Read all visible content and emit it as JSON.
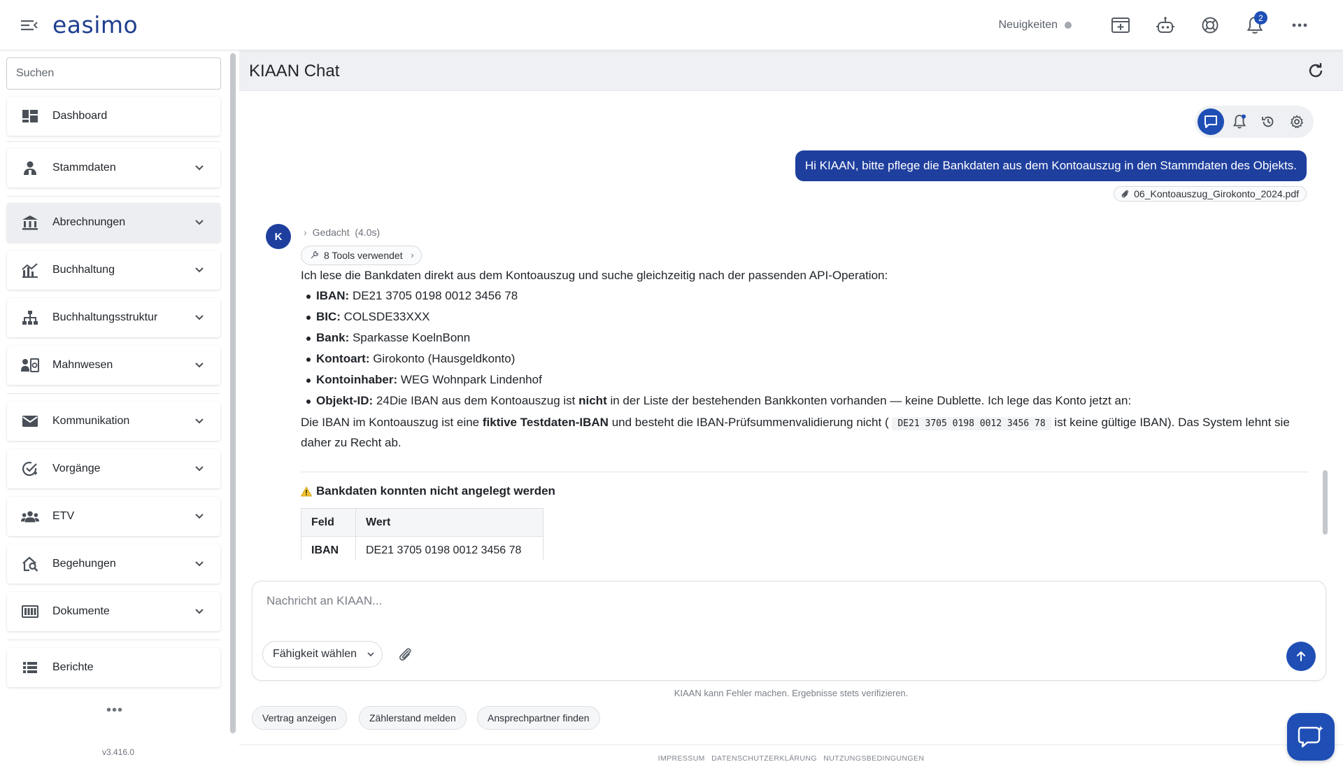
{
  "app": {
    "logo": "easimo",
    "version": "v3.416.0"
  },
  "topbar": {
    "news_label": "Neuigkeiten",
    "notification_count": "2",
    "icons": [
      "add-window-icon",
      "robot-icon",
      "support-icon",
      "bell-icon",
      "more-icon"
    ]
  },
  "sidebar": {
    "search_placeholder": "Suchen",
    "items": [
      {
        "label": "Dashboard",
        "icon": "dashboard-icon"
      },
      {
        "label": "Stammdaten",
        "icon": "person-icon"
      },
      {
        "label": "Abrechnungen",
        "icon": "bank-icon"
      },
      {
        "label": "Buchhaltung",
        "icon": "chart-icon"
      },
      {
        "label": "Buchhaltungsstruktur",
        "icon": "hierarchy-icon"
      },
      {
        "label": "Mahnwesen",
        "icon": "reminder-icon"
      },
      {
        "label": "Kommunikation",
        "icon": "mail-icon"
      },
      {
        "label": "Vorgänge",
        "icon": "task-icon"
      },
      {
        "label": "ETV",
        "icon": "group-icon"
      },
      {
        "label": "Begehungen",
        "icon": "inspection-icon"
      },
      {
        "label": "Dokumente",
        "icon": "documents-icon"
      },
      {
        "label": "Berichte",
        "icon": "list-icon"
      }
    ],
    "more": "•••"
  },
  "chat": {
    "title": "KIAAN Chat",
    "user_message": "Hi KIAAN, bitte pflege die Bankdaten aus dem Kontoauszug in den Stammdaten des Objekts.",
    "attachment": "06_Kontoauszug_Girokonto_2024.pdf",
    "avatar_letter": "K",
    "thought": "Gedacht",
    "thought_time": "(4.0s)",
    "tools": "8 Tools verwendet",
    "intro": "Ich lese die Bankdaten direkt aus dem Kontoauszug und suche gleichzeitig nach der passenden API-Operation:",
    "bullets": [
      {
        "key": "IBAN:",
        "value": " DE21 3705 0198 0012 3456 78"
      },
      {
        "key": "BIC:",
        "value": " COLSDE33XXX"
      },
      {
        "key": "Bank:",
        "value": " Sparkasse KoelnBonn"
      },
      {
        "key": "Kontoart:",
        "value": " Girokonto (Hausgeldkonto)"
      },
      {
        "key": "Kontoinhaber:",
        "value": " WEG Wohnpark Lindenhof"
      }
    ],
    "last_bullet": {
      "key": "Objekt-ID:",
      "value_pre": " 24Die IBAN aus dem Kontoauszug ist ",
      "value_bold": "nicht",
      "value_post": " in der Liste der bestehenden Bankkonten vorhanden — keine Dublette. Ich lege das Konto jetzt an:"
    },
    "para": {
      "pre": "Die IBAN im Kontoauszug ist eine ",
      "bold": "fiktive Testdaten-IBAN",
      "mid": " und besteht die IBAN-Prüfsummenvalidierung nicht (",
      "code": "DE21 3705 0198 0012 3456 78",
      "post": " ist keine gültige IBAN). Das System lehnt sie daher zu Recht ab."
    },
    "warning_title": "Bankdaten konnten nicht angelegt werden",
    "table": {
      "headers": [
        "Feld",
        "Wert"
      ],
      "rows": [
        [
          "IBAN",
          "DE21 3705 0198 0012 3456 78"
        ]
      ]
    }
  },
  "composer": {
    "placeholder": "Nachricht an KIAAN...",
    "skill_label": "Fähigkeit wählen"
  },
  "disclaimer": "KIAAN kann Fehler machen. Ergebnisse stets verifizieren.",
  "suggestions": [
    "Vertrag anzeigen",
    "Zählerstand melden",
    "Ansprechpartner finden"
  ],
  "footer": [
    "IMPRESSUM",
    "DATENSCHUTZERKLÄRUNG",
    "NUTZUNGSBEDINGUNGEN"
  ],
  "colors": {
    "brand": "#1f3f9e",
    "accent": "#1f4fb5"
  }
}
